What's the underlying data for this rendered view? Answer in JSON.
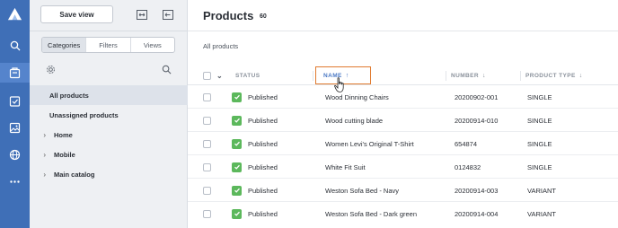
{
  "rail": {
    "icons": [
      "logo-icon",
      "search-icon",
      "catalog-icon",
      "tasks-icon",
      "image-icon",
      "globe-icon",
      "more-icon"
    ]
  },
  "sidebar": {
    "save_view_label": "Save view",
    "tabs": [
      {
        "label": "Categories",
        "active": true
      },
      {
        "label": "Filters",
        "active": false
      },
      {
        "label": "Views",
        "active": false
      }
    ],
    "items": [
      {
        "label": "All products",
        "selected": true,
        "expandable": false
      },
      {
        "label": "Unassigned products",
        "selected": false,
        "expandable": false
      },
      {
        "label": "Home",
        "selected": false,
        "expandable": true
      },
      {
        "label": "Mobile",
        "selected": false,
        "expandable": true
      },
      {
        "label": "Main catalog",
        "selected": false,
        "expandable": true
      }
    ]
  },
  "header": {
    "title": "Products",
    "count": "60",
    "breadcrumb": "All products"
  },
  "table": {
    "columns": {
      "status": "STATUS",
      "name": "NAME",
      "number": "NUMBER",
      "product_type": "PRODUCT TYPE"
    },
    "sort": {
      "column": "name",
      "direction": "asc"
    },
    "rows": [
      {
        "status": "Published",
        "name": "Wood Dinning Chairs",
        "number": "20200902-001",
        "type": "SINGLE"
      },
      {
        "status": "Published",
        "name": "Wood cutting blade",
        "number": "20200914-010",
        "type": "SINGLE"
      },
      {
        "status": "Published",
        "name": "Women Levi's Original T-Shirt",
        "number": "654874",
        "type": "SINGLE"
      },
      {
        "status": "Published",
        "name": "White Fit Suit",
        "number": "0124832",
        "type": "SINGLE"
      },
      {
        "status": "Published",
        "name": "Weston Sofa Bed - Navy",
        "number": "20200914-003",
        "type": "VARIANT"
      },
      {
        "status": "Published",
        "name": "Weston Sofa Bed - Dark green",
        "number": "20200914-004",
        "type": "VARIANT"
      }
    ]
  },
  "colors": {
    "rail": "#3f6fb7",
    "status_published": "#5cb85c",
    "sort_highlight": "#e07a2f",
    "sort_text": "#4a78c4"
  }
}
